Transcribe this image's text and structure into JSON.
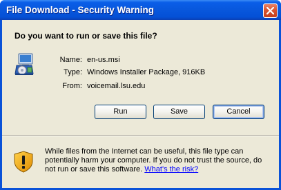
{
  "window": {
    "title": "File Download - Security Warning"
  },
  "question": "Do you want to run or save this file?",
  "file": {
    "icon": "msi-installer-icon",
    "name_label": "Name:",
    "name_value": "en-us.msi",
    "type_label": "Type:",
    "type_value": "Windows Installer Package, 916KB",
    "from_label": "From:",
    "from_value": "voicemail.lsu.edu"
  },
  "buttons": {
    "run": "Run",
    "save": "Save",
    "cancel": "Cancel"
  },
  "warning": {
    "icon": "shield-warning-icon",
    "text": "While files from the Internet can be useful, this file type can potentially harm your computer. If you do not trust the source, do not run or save this software.",
    "link": "What's the risk?"
  },
  "colors": {
    "titlebar": "#0a5ee8",
    "client": "#ece9d8",
    "close": "#d9532f",
    "link": "#0000ff"
  }
}
